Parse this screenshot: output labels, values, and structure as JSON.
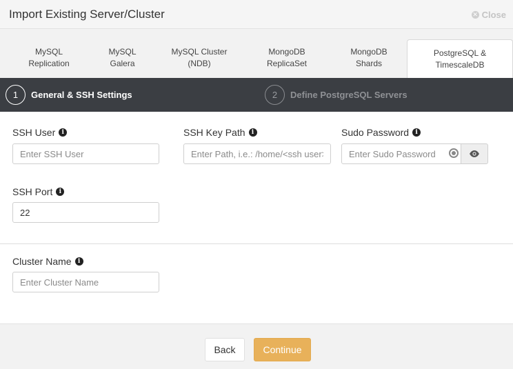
{
  "dialog": {
    "title": "Import Existing Server/Cluster",
    "close_label": "Close"
  },
  "tabs": [
    {
      "line1": "MySQL",
      "line2": "Replication"
    },
    {
      "line1": "MySQL",
      "line2": "Galera"
    },
    {
      "line1": "MySQL Cluster",
      "line2": "(NDB)"
    },
    {
      "line1": "MongoDB",
      "line2": "ReplicaSet"
    },
    {
      "line1": "MongoDB",
      "line2": "Shards"
    },
    {
      "line1": "PostgreSQL &",
      "line2": "TimescaleDB"
    }
  ],
  "active_tab": 5,
  "steps": [
    {
      "num": "1",
      "label": "General & SSH Settings"
    },
    {
      "num": "2",
      "label": "Define PostgreSQL Servers"
    }
  ],
  "form": {
    "ssh_user": {
      "label": "SSH User",
      "placeholder": "Enter SSH User",
      "value": ""
    },
    "ssh_key_path": {
      "label": "SSH Key Path",
      "placeholder": "Enter Path, i.e.: /home/<ssh user>/.ssh/id_rsa",
      "value": ""
    },
    "sudo_password": {
      "label": "Sudo Password",
      "placeholder": "Enter Sudo Password",
      "value": ""
    },
    "ssh_port": {
      "label": "SSH Port",
      "placeholder": "",
      "value": "22"
    },
    "cluster_name": {
      "label": "Cluster Name",
      "placeholder": "Enter Cluster Name",
      "value": ""
    }
  },
  "icons": {
    "info": "info-icon",
    "key": "key-icon",
    "eye": "eye-icon",
    "close": "close-icon"
  },
  "footer": {
    "back_label": "Back",
    "continue_label": "Continue"
  },
  "colors": {
    "accent": "#e8b15a",
    "wizard_bg": "#3b3e43"
  }
}
